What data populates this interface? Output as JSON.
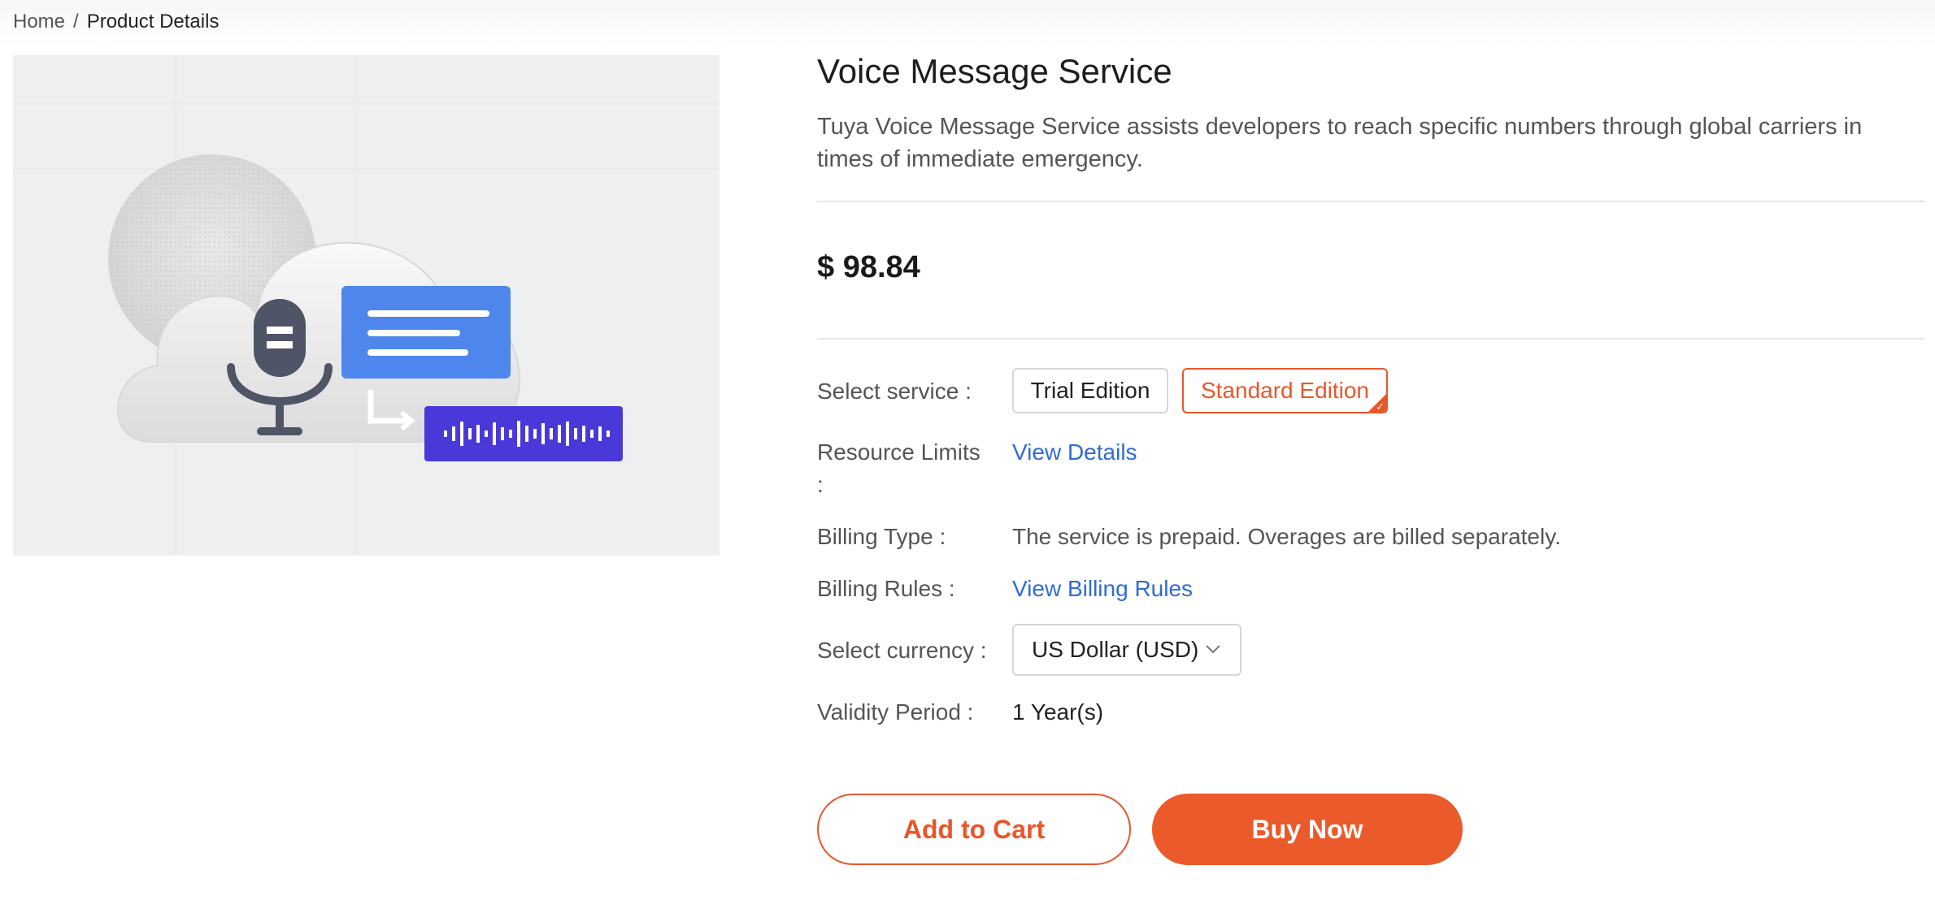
{
  "breadcrumb": {
    "home": "Home",
    "separator": "/",
    "current": "Product Details"
  },
  "product": {
    "title": "Voice Message Service",
    "description": "Tuya Voice Message Service assists developers to reach specific numbers through global carriers in times of immediate emergency.",
    "price": "$ 98.84",
    "image_icon": "cloud-voice-message-illustration"
  },
  "details": {
    "select_service_label": "Select service :",
    "service_options": [
      {
        "label": "Trial Edition",
        "selected": false
      },
      {
        "label": "Standard Edition",
        "selected": true
      }
    ],
    "resource_limits_label": "Resource Limits :",
    "resource_limits_link": "View Details",
    "billing_type_label": "Billing Type :",
    "billing_type_value": "The service is prepaid. Overages are billed separately.",
    "billing_rules_label": "Billing Rules :",
    "billing_rules_link": "View Billing Rules",
    "currency_label": "Select currency :",
    "currency_value": "US Dollar (USD)",
    "validity_label": "Validity Period :",
    "validity_value": "1 Year(s)"
  },
  "actions": {
    "add_to_cart": "Add to Cart",
    "buy_now": "Buy Now"
  },
  "colors": {
    "accent": "#eb5a2a",
    "link": "#2f6bd8",
    "selected_border": "#e8572a",
    "hero_bg": "#efefef"
  }
}
